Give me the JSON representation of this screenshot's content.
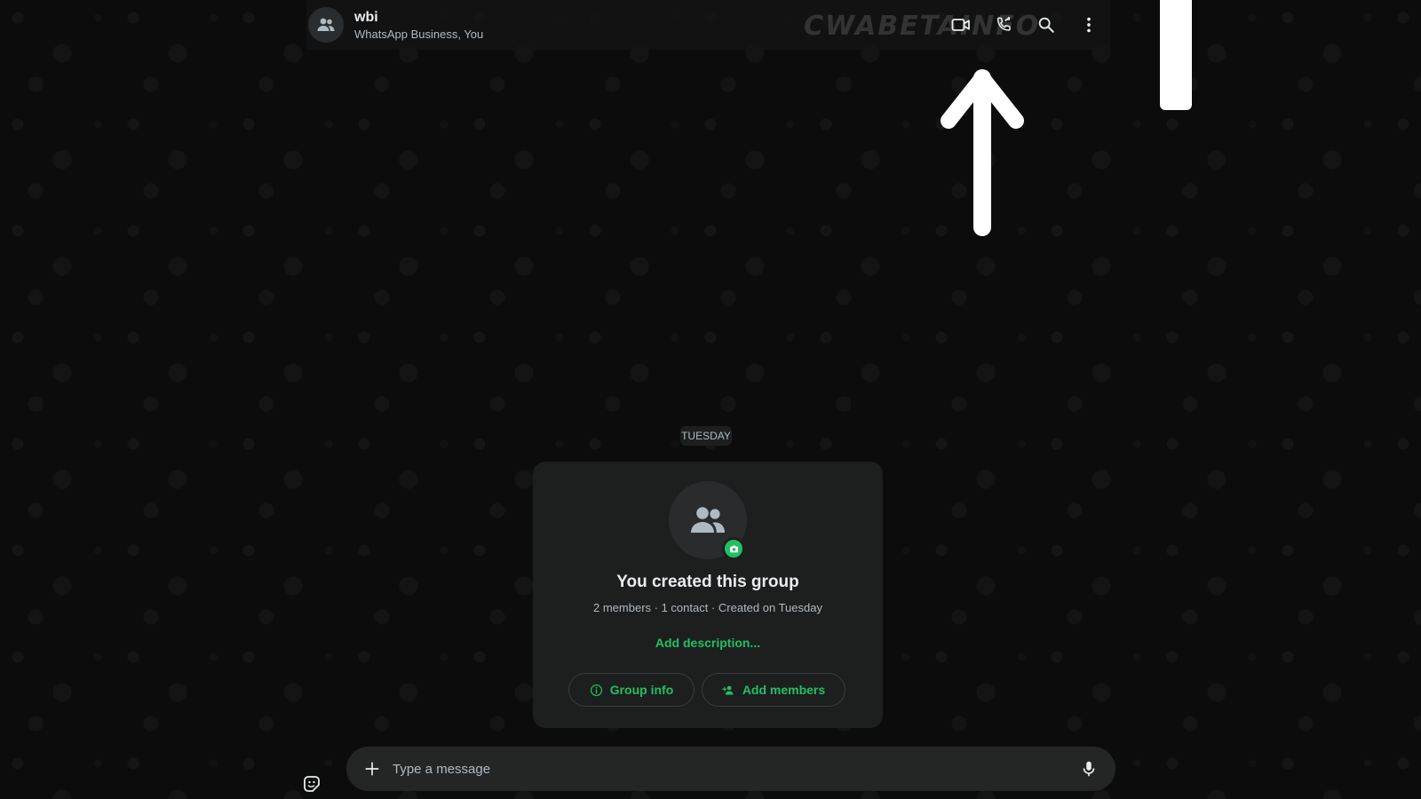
{
  "header": {
    "title": "wbi",
    "subtitle": "WhatsApp Business, You",
    "watermark": "CWABETAINFO",
    "actions": [
      "video-call-icon",
      "voice-call-icon",
      "search-icon",
      "menu-icon"
    ]
  },
  "conversation": {
    "date_label": "TUESDAY",
    "system_card": {
      "title": "You created this group",
      "meta": "2 members · 1 contact · Created on Tuesday",
      "add_description": "Add description...",
      "group_info_label": "Group info",
      "add_members_label": "Add members"
    }
  },
  "composer": {
    "placeholder": "Type a message",
    "value": ""
  },
  "colors": {
    "accent": "#21c063",
    "background": "#0c0c0c",
    "panel": "#1d1e1e",
    "text_primary": "#e9edef",
    "text_secondary": "#aebac1"
  }
}
